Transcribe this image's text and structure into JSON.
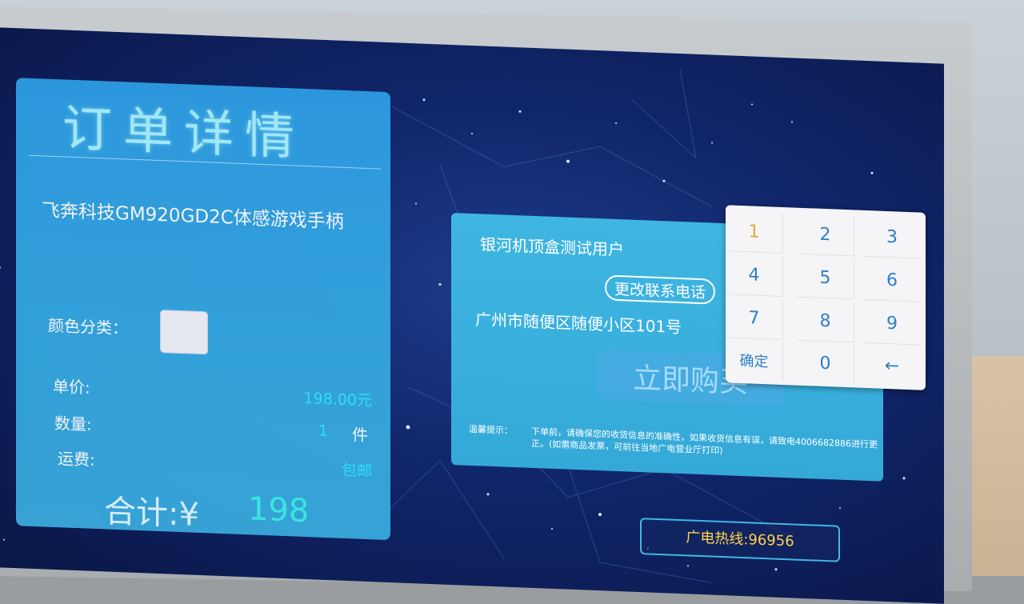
{
  "order": {
    "title": "订单详情",
    "product_name": "飞奔科技GM920GD2C体感游戏手柄",
    "color_label": "颜色分类：",
    "price_label": "单价:",
    "price_value": "198.00元",
    "quantity_label": "数量:",
    "quantity_value": "1",
    "quantity_unit": "件",
    "shipping_label": "运费:",
    "shipping_value": "包邮",
    "total_label": "合计:¥",
    "total_value": "198"
  },
  "address": {
    "user_name": "银河机顶盒测试用户",
    "change_phone_label": "更改联系电话",
    "address_text": "广州市随便区随便小区101号",
    "buy_label": "立即购买",
    "tip_label": "温馨提示：",
    "tip_text": "下单前，请确保您的收货信息的准确性，如果收货信息有误，请致电4006682886进行更正。(如需商品发票，可前往当地广电营业厅打印)"
  },
  "keypad": {
    "keys": [
      "1",
      "2",
      "3",
      "4",
      "5",
      "6",
      "7",
      "8",
      "9",
      "确定",
      "0",
      "←"
    ]
  },
  "hotline": "广电热线:96956",
  "colors": {
    "accent_cyan": "#2ee8ff",
    "highlight_key": "#e2a73a",
    "hotline_text": "#ffd24a"
  }
}
